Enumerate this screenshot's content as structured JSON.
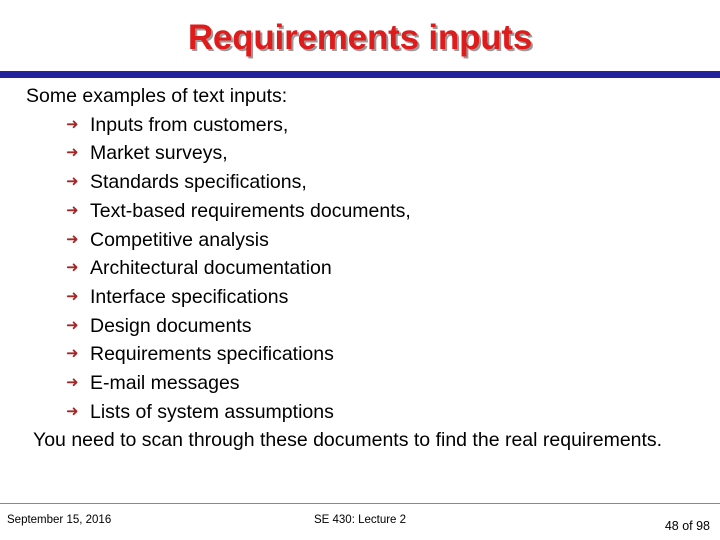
{
  "slide": {
    "title": "Requirements inputs",
    "title_color": "#E01B1B",
    "title_shadow_color": "#9A9A9A",
    "divider_color": "#23239E",
    "background_color": "#FFFFFF",
    "body": {
      "lead_line": "Some examples of text inputs:",
      "bullet_glyph": "➜",
      "bullet_icon_name": "arrowhead-bullet-icon",
      "bullet_color": "#A52828",
      "items": [
        {
          "label": "Inputs from customers,"
        },
        {
          "label": "Market surveys,"
        },
        {
          "label": "Standards specifications,"
        },
        {
          "label": "Text-based requirements documents,"
        },
        {
          "label": "Competitive analysis"
        },
        {
          "label": "Architectural documentation"
        },
        {
          "label": "Interface specifications"
        },
        {
          "label": "Design documents"
        },
        {
          "label": "Requirements specifications"
        },
        {
          "label": "E-mail messages"
        },
        {
          "label": "Lists of system assumptions"
        }
      ],
      "closing_line": "You need to scan through these documents to find the real requirements."
    },
    "footer": {
      "date": "September 15, 2016",
      "course": "SE 430: Lecture 2",
      "page": "48 of 98"
    }
  }
}
